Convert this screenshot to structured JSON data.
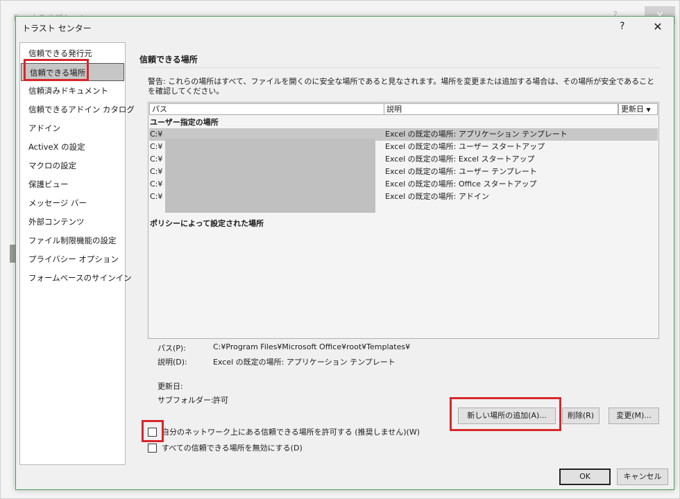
{
  "background_window": {
    "title": "Excel のオプション",
    "help": "?",
    "close": "✕"
  },
  "dialog": {
    "title": "トラスト センター",
    "help": "?",
    "close": "✕"
  },
  "sidebar": {
    "items": [
      {
        "label": "信頼できる発行元"
      },
      {
        "label": "信頼できる場所"
      },
      {
        "label": "信頼済みドキュメント"
      },
      {
        "label": "信頼できるアドイン カタログ"
      },
      {
        "label": "アドイン"
      },
      {
        "label": "ActiveX の設定"
      },
      {
        "label": "マクロの設定"
      },
      {
        "label": "保護ビュー"
      },
      {
        "label": "メッセージ バー"
      },
      {
        "label": "外部コンテンツ"
      },
      {
        "label": "ファイル制限機能の設定"
      },
      {
        "label": "プライバシー オプション"
      },
      {
        "label": "フォームベースのサインイン"
      }
    ],
    "selected_index": 1
  },
  "main": {
    "section_title": "信頼できる場所",
    "warning": "警告: これらの場所はすべて、ファイルを開くのに安全な場所であると見なされます。場所を変更または追加する場合は、その場所が安全であることを確認してください。",
    "columns": {
      "path": "パス",
      "description": "説明",
      "modified": "更新日"
    },
    "sort_arrow": "▼",
    "group_user": "ユーザー指定の場所",
    "rows": [
      {
        "path": "C:¥",
        "description": "Excel の既定の場所: アプリケーション テンプレート"
      },
      {
        "path": "C:¥",
        "description": "Excel の既定の場所: ユーザー スタートアップ"
      },
      {
        "path": "C:¥",
        "description": "Excel の既定の場所: Excel スタートアップ"
      },
      {
        "path": "C:¥",
        "description": "Excel の既定の場所: ユーザー テンプレート"
      },
      {
        "path": "C:¥",
        "description": "Excel の既定の場所: Office スタートアップ"
      },
      {
        "path": "C:¥",
        "description": "Excel の既定の場所: アドイン"
      }
    ],
    "group_policy": "ポリシーによって設定された場所",
    "details": {
      "path_label": "パス(P):",
      "path_value": "C:¥Program Files¥Microsoft Office¥root¥Templates¥",
      "desc_label": "説明(D):",
      "desc_value": "Excel の既定の場所: アプリケーション テンプレート",
      "modified_label": "更新日:",
      "subfolder_label": "サブフォルダー:",
      "subfolder_value": "許可"
    },
    "buttons": {
      "add": "新しい場所の追加(A)...",
      "delete": "削除(R)",
      "modify": "変更(M)..."
    },
    "checkboxes": {
      "allow_network": "自分のネットワーク上にある信頼できる場所を許可する (推奨しません)(W)",
      "disable_all": "すべての信頼できる場所を無効にする(D)"
    }
  },
  "footer": {
    "ok": "OK",
    "cancel": "キャンセル"
  },
  "colors": {
    "highlight": "#d8262a",
    "dialog_border": "#4e9a62",
    "selection": "#c6c6c6"
  }
}
